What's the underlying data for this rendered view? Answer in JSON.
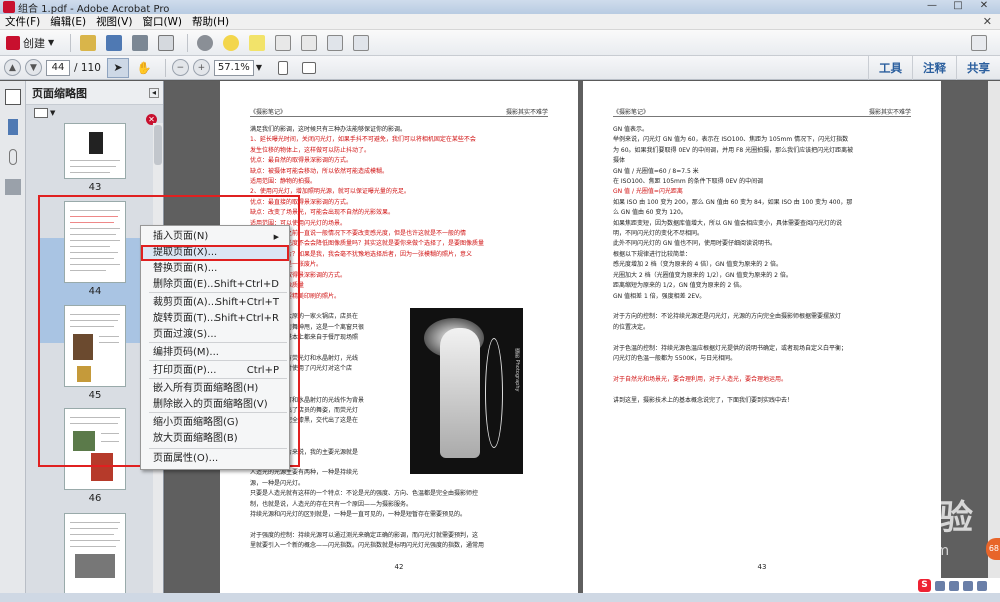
{
  "window": {
    "title": "组合 1.pdf - Adobe Acrobat Pro"
  },
  "menubar": [
    "文件(F)",
    "编辑(E)",
    "视图(V)",
    "窗口(W)",
    "帮助(H)"
  ],
  "toolbar1": {
    "create_label": "创建"
  },
  "toolbar2": {
    "page_current": "44",
    "page_total": "/ 110",
    "zoom": "57.1%",
    "right_tabs": [
      "工具",
      "注释",
      "共享"
    ]
  },
  "thumb_panel": {
    "title": "页面缩略图",
    "thumbs": [
      {
        "num": "43"
      },
      {
        "num": "44"
      },
      {
        "num": "45"
      },
      {
        "num": "46"
      }
    ]
  },
  "context_menu": [
    {
      "label": "插入页面(N)",
      "shortcut": "",
      "submenu": "▶"
    },
    {
      "label": "提取页面(X)...",
      "shortcut": ""
    },
    {
      "label": "替换页面(R)...",
      "shortcut": ""
    },
    {
      "label": "删除页面(E)...",
      "shortcut": "Shift+Ctrl+D"
    },
    {
      "label": "裁剪页面(A)...",
      "shortcut": "Shift+Ctrl+T"
    },
    {
      "label": "旋转页面(T)...",
      "shortcut": "Shift+Ctrl+R"
    },
    {
      "label": "页面过渡(S)...",
      "shortcut": ""
    },
    {
      "label": "编排页码(M)...",
      "shortcut": ""
    },
    {
      "label": "打印页面(P)...",
      "shortcut": "Ctrl+P"
    },
    {
      "label": "嵌入所有页面缩略图(H)",
      "shortcut": ""
    },
    {
      "label": "删除嵌入的页面缩略图(V)",
      "shortcut": ""
    },
    {
      "label": "缩小页面缩略图(G)",
      "shortcut": ""
    },
    {
      "label": "放大页面缩略图(B)",
      "shortcut": ""
    },
    {
      "label": "页面属性(O)...",
      "shortcut": ""
    }
  ],
  "doc": {
    "page42": {
      "header_left": "《摄影笔记》",
      "header_right": "摄影其实不难学",
      "lines": [
        {
          "t": "满足我们的影调，这时候只有三种办法能够保证你的影调。",
          "red": false
        },
        {
          "t": "1、延长曝光时间，关闭闪光灯，如果手抖不可避免，我们可以将相机固定在某些不会",
          "red": true
        },
        {
          "t": "发生位移的物体上，这样做可以防止抖动了。",
          "red": true
        },
        {
          "t": "优点：最自然的取得景深影调的方式。",
          "red": true
        },
        {
          "t": "缺点：被摄体可能会移动，所以依然可能造成模糊。",
          "red": true
        },
        {
          "t": "适用范围：静物的拍摄。",
          "red": true
        },
        {
          "t": "2、使用闪光灯，增加照明光源，就可以保证曝光量的充足。",
          "red": true
        },
        {
          "t": "优点：最直接的取得景深影调的方式。",
          "red": true
        },
        {
          "t": "缺点：改变了场景光，可能会出现不自然的光影效果。",
          "red": true
        },
        {
          "t": "适用范围：可以使用闪光灯的场景。",
          "red": true
        },
        {
          "t": "增加感光度，之前一直说一般情况下不要改变感光度，但是也许这就是不一般的情",
          "red": true
        },
        {
          "t": "入这便是对感光度不会会降低图像质量吗？其实这就是要你来做个选择了，是要图像质量",
          "red": true
        },
        {
          "t": "一张清晰的照片？如果是我，我会毫不犹豫地选择后者，因为一张模糊的照片，意义",
          "red": true
        },
        {
          "t": "的画像质量也是一张废片。",
          "red": true
        },
        {
          "t": "点：最简单的取得景深影调的方式。",
          "red": true
        },
        {
          "t": "点：降低了图像质量",
          "red": true
        },
        {
          "t": "用范围：不需要精美印刷的照片。",
          "red": true
        },
        {
          "t": "",
          "red": false
        },
        {
          "t": "张照片拍摄于太原的一家火锅店，店员在",
          "red": false
        },
        {
          "t": "面前挥舞——街舞神甩，这是一个离窗只很",
          "red": false
        },
        {
          "t": "子，所以光线基本上都来自于餐厅现场照",
          "red": false
        },
        {
          "t": "。",
          "red": false
        },
        {
          "t": "场的灯光主要有荧光灯和水晶射灯，光线",
          "red": false
        },
        {
          "t": "弱，因此拍摄时使用了闪光灯对这个店",
          "red": false
        },
        {
          "t": "补光。",
          "red": false
        },
        {
          "t": "",
          "red": false
        },
        {
          "t": "面对室内荧光灯和水晶射灯的光线作为背景",
          "red": false
        },
        {
          "t": "光灯的补光突出了店员的舞姿，而荧光灯",
          "red": false
        },
        {
          "t": "使背景不至于完全漆黑，交代出了这是在",
          "red": false
        },
        {
          "t": "背景。",
          "red": false
        },
        {
          "t": "",
          "red": false
        },
        {
          "t": "以对于这张照片来说，我的主要光源就是",
          "red": false
        },
        {
          "t": "的闪光灯。",
          "red": false
        },
        {
          "t": "人造光的光源主要有两种，一种是持续光",
          "red": false
        },
        {
          "t": "源，一种是闪光灯。",
          "red": false
        },
        {
          "t": "只要是人造光就有这样的一个特点：不论是光的强度、方向、色温都是完全由摄影师控",
          "red": false
        },
        {
          "t": "制，也就是说，人造光的存在只有一个原因——为摄影服务。",
          "red": false
        },
        {
          "t": "持续光源和闪光灯的区别就是，一种是一直可见的，一种是短暂存在需要预见的。",
          "red": false
        },
        {
          "t": "",
          "red": false
        },
        {
          "t": "对于强度的控制：持续光源可以通过测光来确定正确的影调，而闪光灯就需要预判，这",
          "red": false
        },
        {
          "t": "里就要引入一个新的概念——闪光指数。闪光指数就是标明闪光灯光强度的指数，通常用",
          "red": false
        }
      ],
      "page_num": "42",
      "photo_caption": "摄影 Photography"
    },
    "page43": {
      "header_left": "《摄影笔记》",
      "header_right": "摄影其实不难学",
      "lines": [
        {
          "t": "GN 值表示。",
          "red": false
        },
        {
          "t": "举例来说，闪光灯 GN 值为 60，表示在 ISO100、焦距为 105mm 情况下，闪光灯指数",
          "red": false
        },
        {
          "t": "为 60。如果我们要取得 0EV 的中间调，并用 F8 光圈拍摄，那么我们应该把闪光灯距离被",
          "red": false
        },
        {
          "t": "摄体",
          "red": false
        },
        {
          "t": "GN 值 / 光圈值=60 / 8=7.5 米",
          "red": false
        },
        {
          "t": "在 ISO100、焦距 105mm 的条件下取得 0EV 的中间调",
          "red": false
        },
        {
          "t": "GN 值 / 光圈值=闪光距离",
          "red": true
        },
        {
          "t": "如果 ISO 由 100 变为 200，那么 GN 值由 60 变为 84，如果 ISO 由 100 变为 400，那",
          "red": false
        },
        {
          "t": "么 GN 值由 60 变为 120。",
          "red": false
        },
        {
          "t": "如果焦距变短，因为数据库值增大，所以 GN 值会相应变小，具体需要查阅闪光灯的说",
          "red": false
        },
        {
          "t": "明，不同闪光灯的变化不尽相同。",
          "red": false
        },
        {
          "t": "此外不同闪光灯的 GN 值也不同，使用时要仔细阅读说明书。",
          "red": false
        },
        {
          "t": "根据以下规律进行比较简单：",
          "red": false
        },
        {
          "t": "感光度增加 2 档（变为原来的 4 倍），GN 值变为原来的 2 倍。",
          "red": false
        },
        {
          "t": "光圈加大 2 档（光圈值变为原来的 1/2），GN 值变为原来的 2 倍。",
          "red": false
        },
        {
          "t": "距离缩短为原来的 1/2，GN 值变为原来的 2 倍。",
          "red": false
        },
        {
          "t": "GN 值相差 1 倍，强度相差 2EV。",
          "red": false
        },
        {
          "t": "",
          "red": false
        },
        {
          "t": "对于方向的控制：不论持续光源还是闪光灯，光源的方向完全由摄影师根据需要摆放灯",
          "red": false
        },
        {
          "t": "的位置决定。",
          "red": false
        },
        {
          "t": "",
          "red": false
        },
        {
          "t": "对于色温的控制：持续光源色温应根据灯光提供的说明书确定，或者现场自定义白平衡；",
          "red": false
        },
        {
          "t": "闪光灯的色温一般都为 5500K，与日光相同。",
          "red": false
        },
        {
          "t": "",
          "red": false
        },
        {
          "t": "对于自然光和场景光，要合理利用，对于人造光，要合理地运用。",
          "red": true
        },
        {
          "t": "",
          "red": false
        },
        {
          "t": "讲到这里，摄影技术上的基本概念说完了，下面我们要到实践中去！",
          "red": false
        }
      ],
      "page_num": "43"
    }
  },
  "watermark": {
    "main": "Baidu经验",
    "sub": "jingyan.baidu.com"
  },
  "badge": "68"
}
